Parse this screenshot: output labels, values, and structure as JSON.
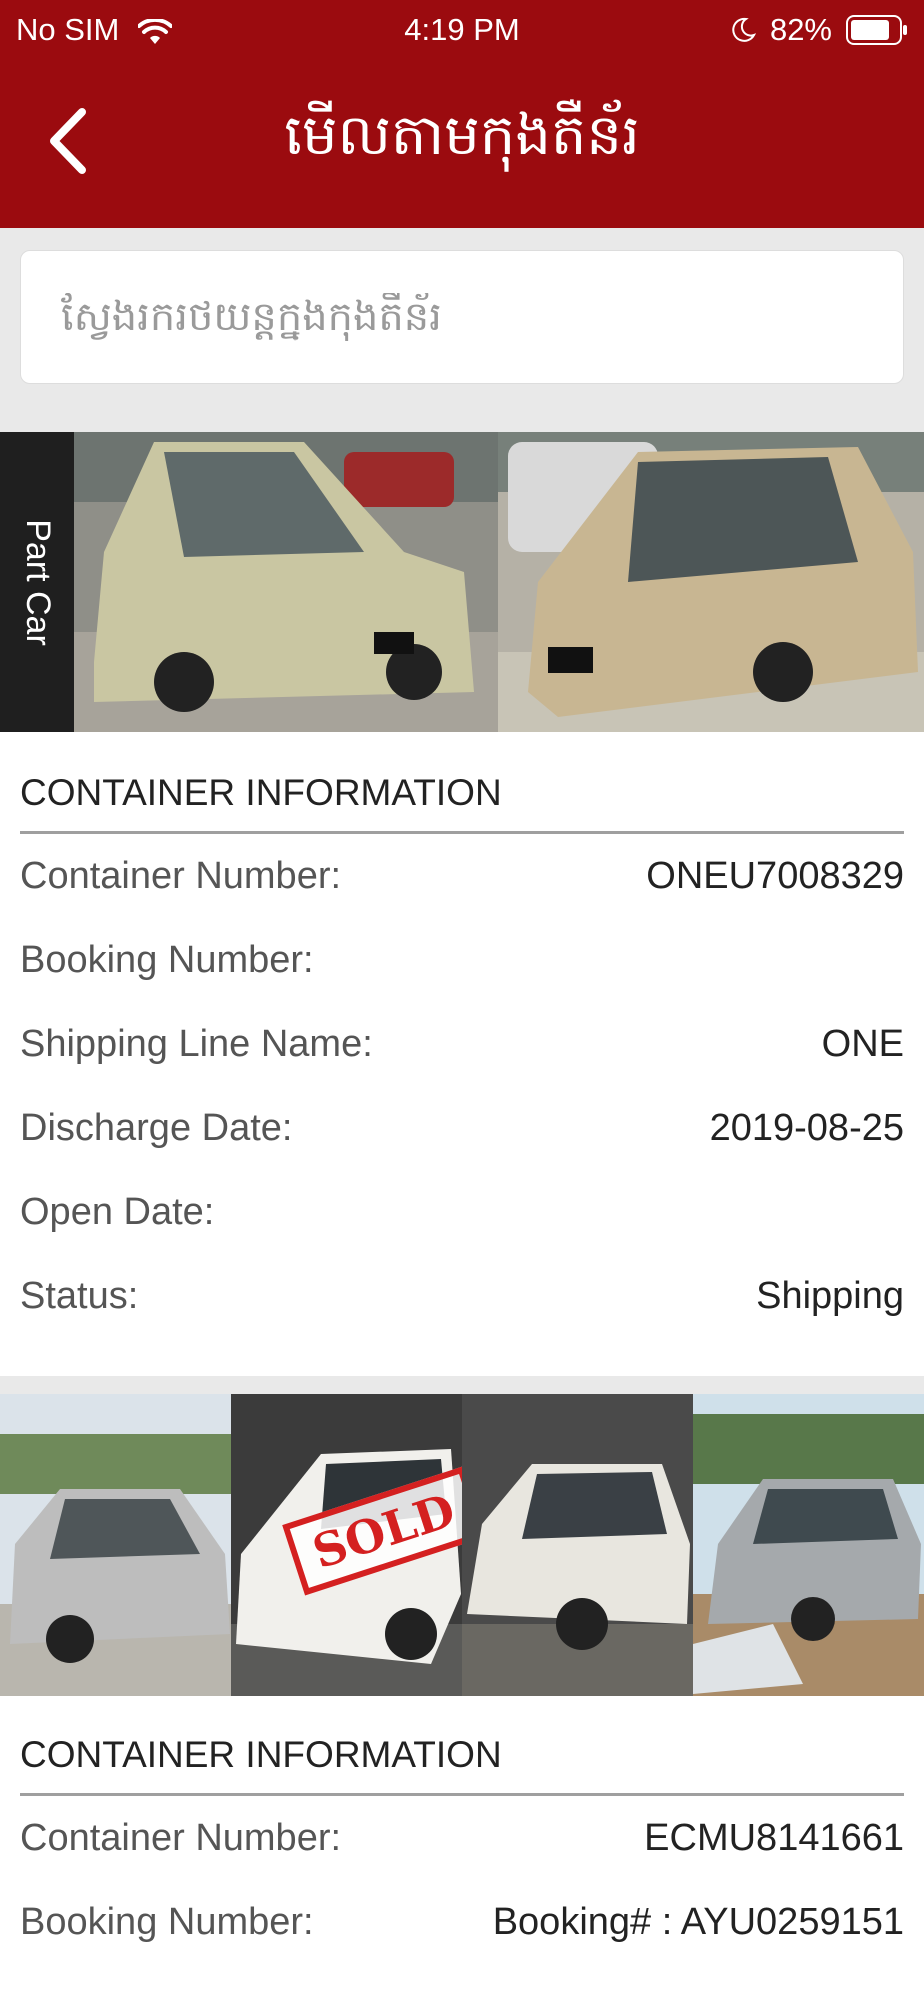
{
  "status_bar": {
    "carrier": "No SIM",
    "time": "4:19 PM",
    "battery": "82%"
  },
  "header": {
    "title": "មើលតាមកុងតឺន័រ"
  },
  "search": {
    "placeholder": "ស្វែងរករថយន្តក្នុងកុងតឺន័រ"
  },
  "containers": [
    {
      "tag": "Part Car",
      "photos": [
        {
          "desc": "green-prius",
          "body": "#c9c6a2",
          "bg": "#8f8f88"
        },
        {
          "desc": "gold-prius",
          "body": "#c8b692",
          "bg": "#b5b1a6"
        }
      ],
      "section_title": "CONTAINER INFORMATION",
      "fields": [
        {
          "label": "Container Number:",
          "value": "ONEU7008329"
        },
        {
          "label": "Booking Number:",
          "value": ""
        },
        {
          "label": "Shipping Line Name:",
          "value": "ONE"
        },
        {
          "label": "Discharge Date:",
          "value": "2019-08-25"
        },
        {
          "label": "Open Date:",
          "value": ""
        },
        {
          "label": "Status:",
          "value": "Shipping"
        }
      ]
    },
    {
      "photos": [
        {
          "desc": "silver-lexus",
          "body": "#bdbdbd",
          "bg": "#9aa3a8",
          "sold": false
        },
        {
          "desc": "white-lexus-sold",
          "body": "#f1f0ec",
          "bg": "#3b3b3b",
          "sold": true,
          "sold_text": "SOLD"
        },
        {
          "desc": "white-rx",
          "body": "#e8e6df",
          "bg": "#4a4a4a",
          "sold": false
        },
        {
          "desc": "silver-rx",
          "body": "#a5a9ac",
          "bg": "#7c8a7a",
          "sold": false
        }
      ],
      "section_title": "CONTAINER INFORMATION",
      "fields": [
        {
          "label": "Container Number:",
          "value": "ECMU8141661"
        },
        {
          "label": "Booking Number:",
          "value": "Booking# : AYU0259151"
        }
      ]
    }
  ]
}
